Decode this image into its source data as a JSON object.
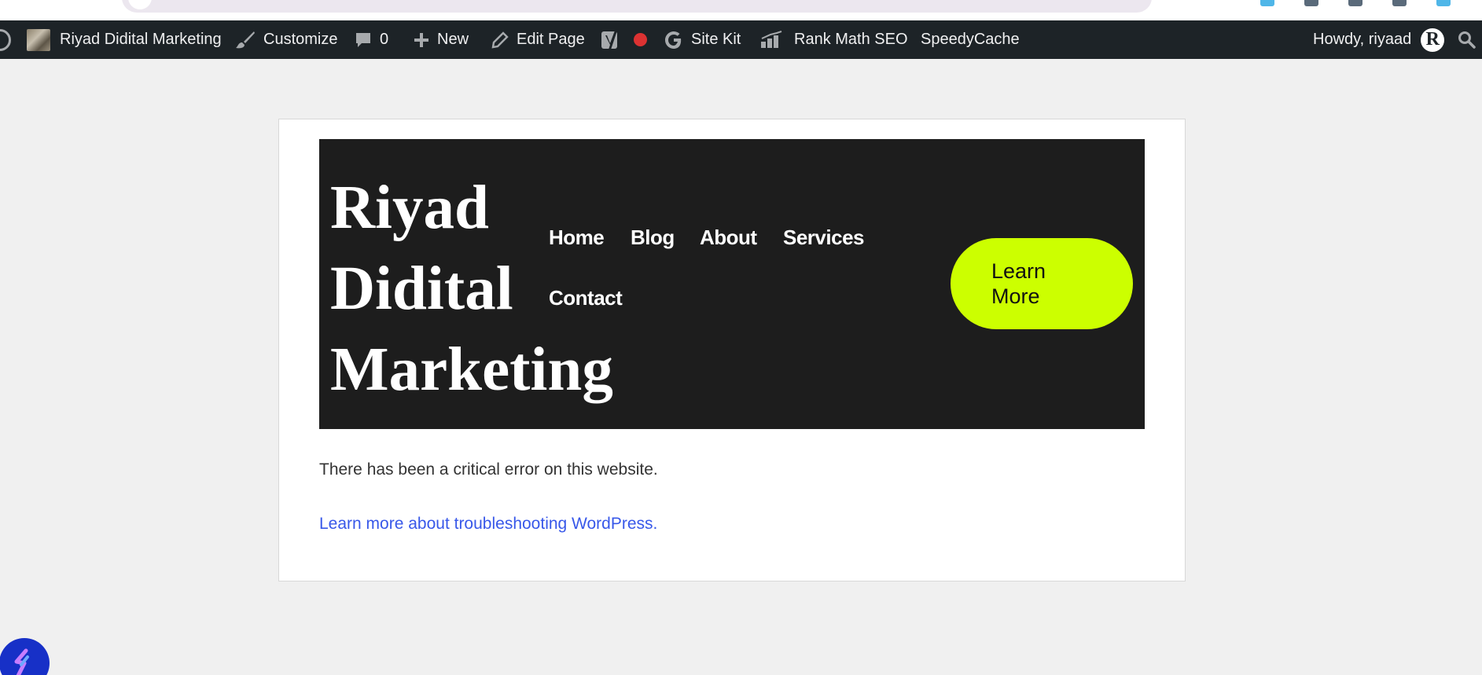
{
  "adminbar": {
    "site_name": "Riyad Didital Marketing",
    "customize": "Customize",
    "comments_count": "0",
    "new": "New",
    "edit_page": "Edit Page",
    "site_kit": "Site Kit",
    "rank_math": "Rank Math SEO",
    "speedycache": "SpeedyCache",
    "howdy": "Howdy, riyaad",
    "avatar_letter": "R"
  },
  "site": {
    "title_line1": "Riyad",
    "title_line2": "Didital",
    "title_line3": "Marketing",
    "nav": [
      "Home",
      "Blog",
      "About",
      "Services",
      "Contact"
    ],
    "cta_label": "Learn More"
  },
  "content": {
    "error_message": "There has been a critical error on this website.",
    "help_link": "Learn more about troubleshooting WordPress."
  },
  "colors": {
    "adminbar_bg": "#1d2327",
    "header_bg": "#1d1d1d",
    "cta_bg": "#ccff00",
    "link": "#3858e9",
    "status_dot": "#dc3232"
  },
  "icons": [
    "wordpress-logo-icon",
    "brush-icon",
    "comment-icon",
    "plus-icon",
    "pencil-icon",
    "yoast-icon",
    "google-g-icon",
    "rank-math-icon",
    "search-icon",
    "widget-logo-icon"
  ]
}
